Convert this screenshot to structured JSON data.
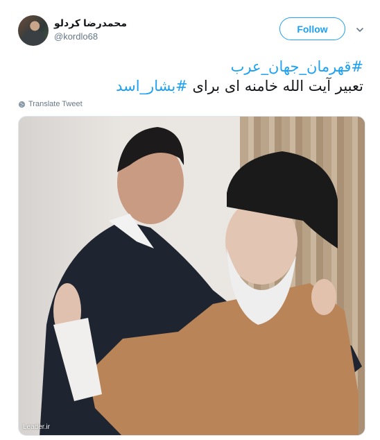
{
  "user": {
    "name": "محمدرضا کردلو",
    "handle": "@kordlo68"
  },
  "actions": {
    "follow_label": "Follow"
  },
  "tweet": {
    "line1_hashtag": "#قهرمان_جهان_عرب",
    "line2_text": "تعبیر آیت الله خامنه ای برای ",
    "line2_hashtag": "#بشار_اسد"
  },
  "translate": {
    "label": "Translate Tweet"
  },
  "media": {
    "watermark": "Leader.ir"
  },
  "colors": {
    "accent": "#1da1f2",
    "secondary_text": "#657786",
    "primary_text": "#14171a"
  }
}
